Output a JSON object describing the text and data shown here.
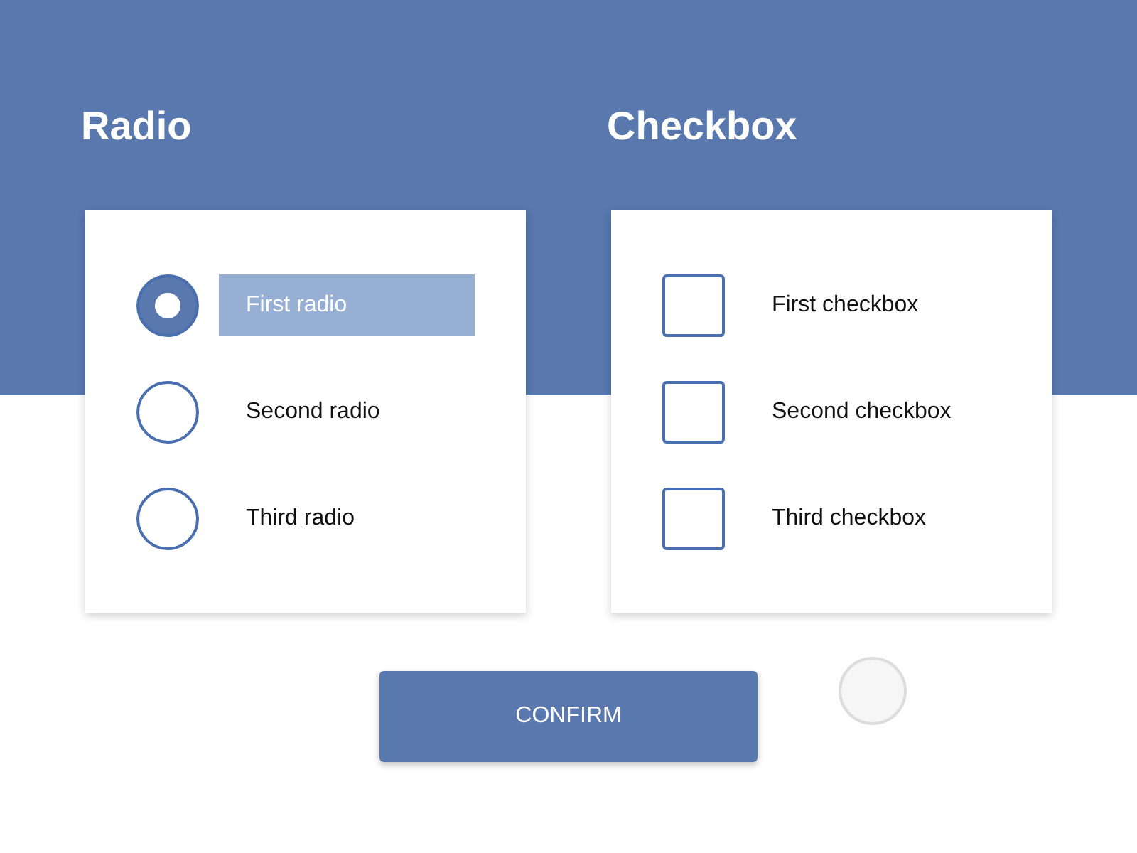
{
  "sections": [
    {
      "title": "Radio",
      "kind": "radio",
      "options": [
        {
          "label": "First radio",
          "selected": true
        },
        {
          "label": "Second radio",
          "selected": false
        },
        {
          "label": "Third radio",
          "selected": false
        }
      ]
    },
    {
      "title": "Checkbox",
      "kind": "checkbox",
      "options": [
        {
          "label": "First checkbox",
          "checked": false
        },
        {
          "label": "Second checkbox",
          "checked": false
        },
        {
          "label": "Third checkbox",
          "checked": false
        }
      ]
    }
  ],
  "confirm_button": {
    "label": "CONFIRM"
  }
}
